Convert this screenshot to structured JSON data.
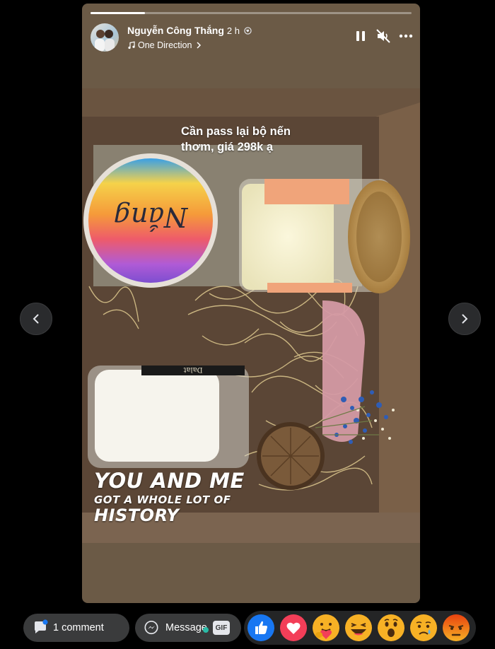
{
  "story": {
    "progress_fraction": 0.17,
    "author": "Nguyễn Công Thắng",
    "time": "2 h",
    "music": "One Direction",
    "caption_line1": "Cần pass lại bộ nến",
    "caption_line2": "thơm, giá 298k ạ",
    "lyric_line1": "YOU AND ME",
    "lyric_line2": "GOT A WHOLE LOT OF",
    "lyric_line3": "HISTORY",
    "jar_label": "Dalat",
    "tin_label": "Nắng"
  },
  "bottom_bar": {
    "comment_label": "1 comment",
    "message_label": "Message",
    "gif_label": "GIF"
  },
  "reactions": [
    "like-icon",
    "love-icon",
    "care-icon",
    "haha-icon",
    "wow-icon",
    "sad-icon",
    "angry-icon"
  ],
  "colors": {
    "like": "#1877f2",
    "love": "#f33e58",
    "emoji_yellow": "#f7b125",
    "angry": "#e9710f",
    "page_bg": "#000000",
    "button_bg": "#3a3b3c"
  }
}
